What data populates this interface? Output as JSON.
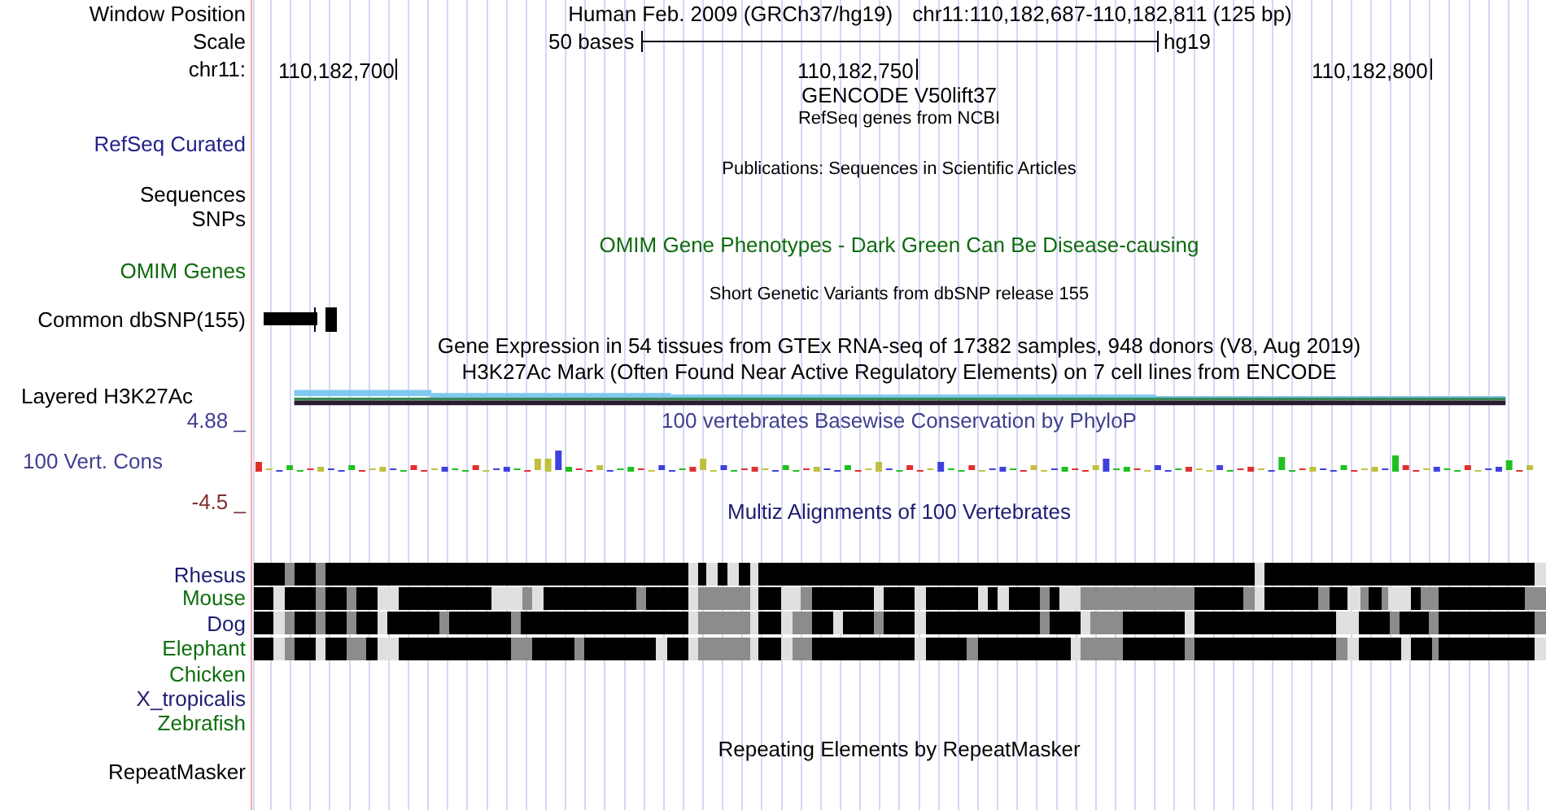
{
  "position": {
    "label": "Window Position",
    "assembly": "Human Feb. 2009 (GRCh37/hg19)",
    "range": "chr11:110,182,687-110,182,811 (125 bp)"
  },
  "scale": {
    "label": "Scale",
    "length": "50 bases",
    "assembly": "hg19"
  },
  "ruler": {
    "label": "chr11:",
    "ticks": [
      "110,182,700",
      "110,182,750",
      "110,182,800"
    ]
  },
  "rows": [
    {
      "kind": "title",
      "text": "GENCODE V50lift37",
      "color": "#000000"
    },
    {
      "kind": "note",
      "text": "RefSeq genes from NCBI"
    },
    {
      "kind": "label",
      "text": "RefSeq Curated",
      "color": "#22228a"
    },
    {
      "kind": "note",
      "text": "Publications: Sequences in Scientific Articles"
    },
    {
      "kind": "label",
      "text": "Sequences",
      "color": "#000000"
    },
    {
      "kind": "label",
      "text": "SNPs",
      "color": "#000000"
    },
    {
      "kind": "title",
      "text": "OMIM Gene Phenotypes - Dark Green Can Be Disease-causing",
      "color": "#0e6b0e"
    },
    {
      "kind": "label",
      "text": "OMIM Genes",
      "color": "#0e6b0e"
    },
    {
      "kind": "note",
      "text": "Short Genetic Variants from dbSNP release 155"
    },
    {
      "kind": "snp",
      "text": "Common dbSNP(155)"
    },
    {
      "kind": "title",
      "text": "Gene Expression in 54 tissues from GTEx RNA-seq of 17382 samples, 948 donors (V8, Aug 2019)",
      "color": "#000000"
    },
    {
      "kind": "title",
      "text": "H3K27Ac Mark (Often Found Near Active Regulatory Elements) on 7 cell lines from ENCODE",
      "color": "#000000"
    },
    {
      "kind": "signal",
      "text": "Layered H3K27Ac"
    },
    {
      "kind": "conservation",
      "label": "100 Vert. Cons",
      "title": "100 vertebrates Basewise Conservation by PhyloP",
      "max": "4.88 _",
      "min": "-4.5 _"
    },
    {
      "kind": "title",
      "text": "Multiz Alignments of 100 Vertebrates",
      "color": "#1c1c72"
    },
    {
      "kind": "species",
      "text": "Rhesus",
      "color": "#1c1c72"
    },
    {
      "kind": "species",
      "text": "Mouse",
      "color": "#0e6e0e"
    },
    {
      "kind": "species",
      "text": "Dog",
      "color": "#1c1c72"
    },
    {
      "kind": "species",
      "text": "Elephant",
      "color": "#0e6e0e"
    },
    {
      "kind": "species",
      "text": "Chicken",
      "color": "#0e6e0e"
    },
    {
      "kind": "species",
      "text": "X_tropicalis",
      "color": "#1c1c72"
    },
    {
      "kind": "species",
      "text": "Zebrafish",
      "color": "#0e6e0e"
    },
    {
      "kind": "title",
      "text": "Repeating Elements by RepeatMasker",
      "color": "#000000"
    },
    {
      "kind": "label",
      "text": "RepeatMasker",
      "color": "#000000"
    }
  ]
}
